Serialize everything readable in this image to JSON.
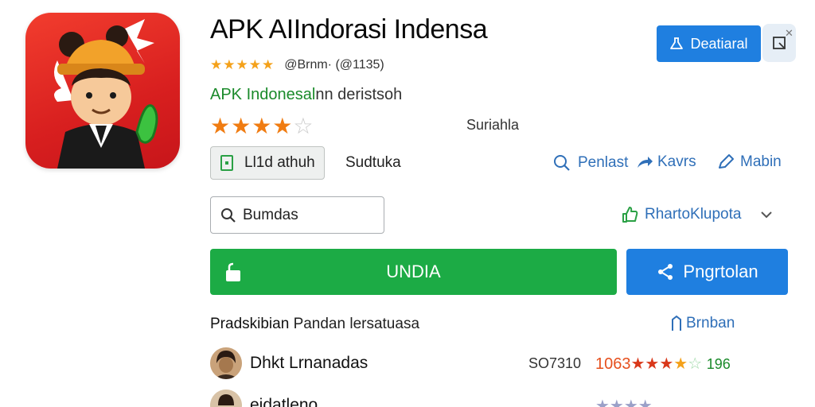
{
  "app": {
    "title": "APK AIIndorasi Indensa",
    "meta_text": "@Brnm· (@1135)",
    "developer_prefix": "APK Indonesal",
    "developer_suffix": "nn deristsoh",
    "rating_label": "Suriahla",
    "tag_label": "Ll1d athuh",
    "category": "Sudtuka"
  },
  "header": {
    "top_button_label": "Deatiaral"
  },
  "actions": {
    "link1": "Penlast",
    "link2": "Kavrs",
    "link3": "Mabin"
  },
  "search": {
    "value": "Bumdas"
  },
  "dropdown": {
    "label": "RhartoKlupota"
  },
  "buttons": {
    "install": "UNDIA",
    "share": "Pngrtolan"
  },
  "reviews": {
    "title_bold": "Pradskibian",
    "title_rest": "Pandan lersatuasa",
    "link": "Brnban",
    "items": [
      {
        "name": "Dhkt Lrnanadas",
        "date": "SO7310",
        "rating_text": "1063",
        "count": "196"
      },
      {
        "name": "eidatleno",
        "date": "",
        "rating_text": "",
        "count": ""
      }
    ]
  },
  "colors": {
    "accent_blue": "#1f7fe0",
    "install_green": "#1cab45",
    "developer_green": "#1a8a2a",
    "star_orange": "#f07c12",
    "icon_red": "#e02a24"
  },
  "icons": [
    "flask-icon",
    "export-icon",
    "close-icon",
    "search-icon",
    "share-icon",
    "edit-icon",
    "like-icon",
    "chevron-down-icon",
    "lock-icon",
    "bookmark-icon"
  ]
}
